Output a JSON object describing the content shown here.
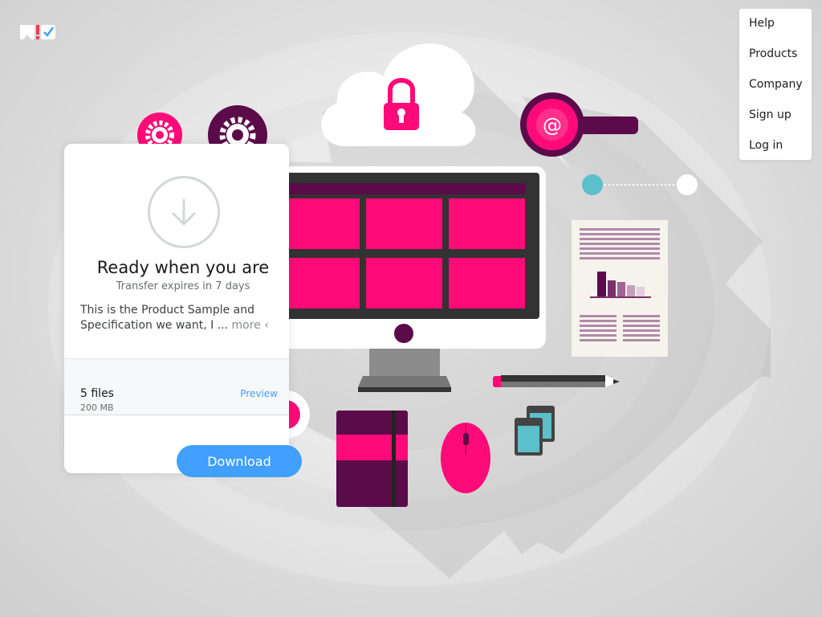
{
  "colors": {
    "accent_pink": "#ff0a78",
    "dark_purple": "#5c0b4a",
    "button_blue": "#409fff",
    "teal": "#5bbfcc"
  },
  "logo": {
    "icon": "wetransfer-logo-icon"
  },
  "menu": {
    "items": [
      {
        "label": "Help"
      },
      {
        "label": "Products"
      },
      {
        "label": "Company"
      },
      {
        "label": "Sign up"
      },
      {
        "label": "Log in"
      }
    ]
  },
  "transfer": {
    "icon": "download-arrow-icon",
    "title": "Ready when you are",
    "subtitle": "Transfer expires in 7 days",
    "message": "This is the Product Sample and Specification we want, I ...",
    "more_label": "more",
    "files": {
      "count": "5 files",
      "size": "200 MB",
      "preview_label": "Preview"
    },
    "download_label": "Download"
  }
}
